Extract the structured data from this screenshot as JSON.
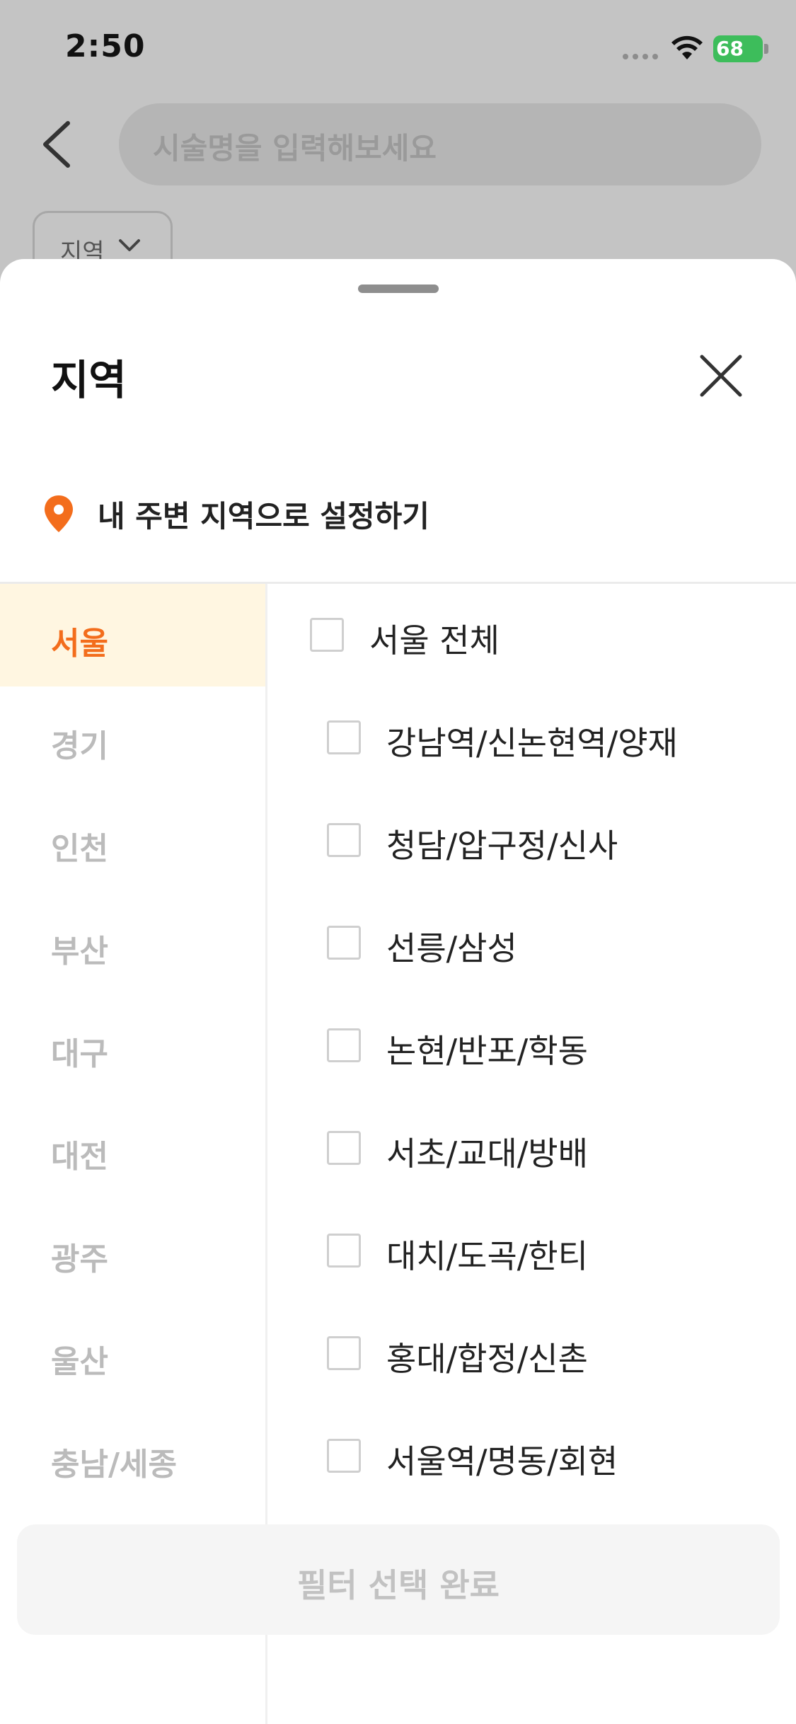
{
  "status_bar": {
    "time": "2:50",
    "battery": "68"
  },
  "search": {
    "placeholder": "시술명을 입력해보세요"
  },
  "filter_chip": {
    "label": "지역"
  },
  "sheet": {
    "title": "지역",
    "nearby_label": "내 주변 지역으로 설정하기",
    "regions": [
      "서울",
      "경기",
      "인천",
      "부산",
      "대구",
      "대전",
      "광주",
      "울산",
      "충남/세종"
    ],
    "active_region": "서울",
    "subregions": [
      {
        "label": "서울 전체",
        "checked": false
      },
      {
        "label": "강남역/신논현역/양재",
        "checked": false
      },
      {
        "label": "청담/압구정/신사",
        "checked": false
      },
      {
        "label": "선릉/삼성",
        "checked": false
      },
      {
        "label": "논현/반포/학동",
        "checked": false
      },
      {
        "label": "서초/교대/방배",
        "checked": false
      },
      {
        "label": "대치/도곡/한티",
        "checked": false
      },
      {
        "label": "홍대/합정/신촌",
        "checked": false
      },
      {
        "label": "서울역/명동/회현",
        "checked": false
      }
    ],
    "confirm_label": "필터 선택 완료"
  },
  "colors": {
    "accent": "#f36d1c",
    "active_bg": "#fff6e1"
  }
}
